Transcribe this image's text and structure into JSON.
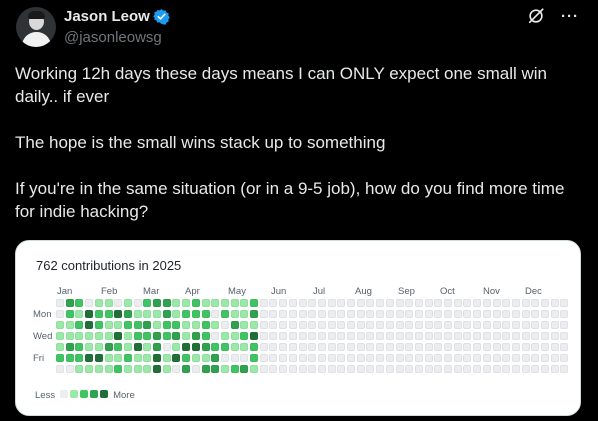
{
  "author": {
    "display_name": "Jason Leow",
    "handle": "@jasonleowsg"
  },
  "icons": {
    "verified": "verified-badge-icon",
    "grok": "grok-icon",
    "more": "more-icon"
  },
  "post": {
    "paragraphs": [
      "Working 12h days these days means I can ONLY expect one small win daily.. if ever",
      "The hope is the small wins stack up to something",
      "If you're in the same situation (or in a 9-5 job), how do you find more time for indie hacking?"
    ]
  },
  "contributions": {
    "title": "762 contributions in 2025",
    "months": [
      "Jan",
      "Feb",
      "Mar",
      "Apr",
      "May",
      "Jun",
      "Jul",
      "Aug",
      "Sep",
      "Oct",
      "Nov",
      "Dec"
    ],
    "day_labels": [
      "Mon",
      "Wed",
      "Fri"
    ],
    "legend_less": "Less",
    "legend_more": "More",
    "level_colors": [
      "#ebedf0",
      "#9be9a8",
      "#40c463",
      "#30a14e",
      "#216e39"
    ],
    "weeks_total": 53,
    "active_weeks": 21
  },
  "colors": {
    "background": "#000000",
    "verified": "#1d9bf0",
    "text": "#e7e9ea",
    "muted": "#71767b"
  }
}
